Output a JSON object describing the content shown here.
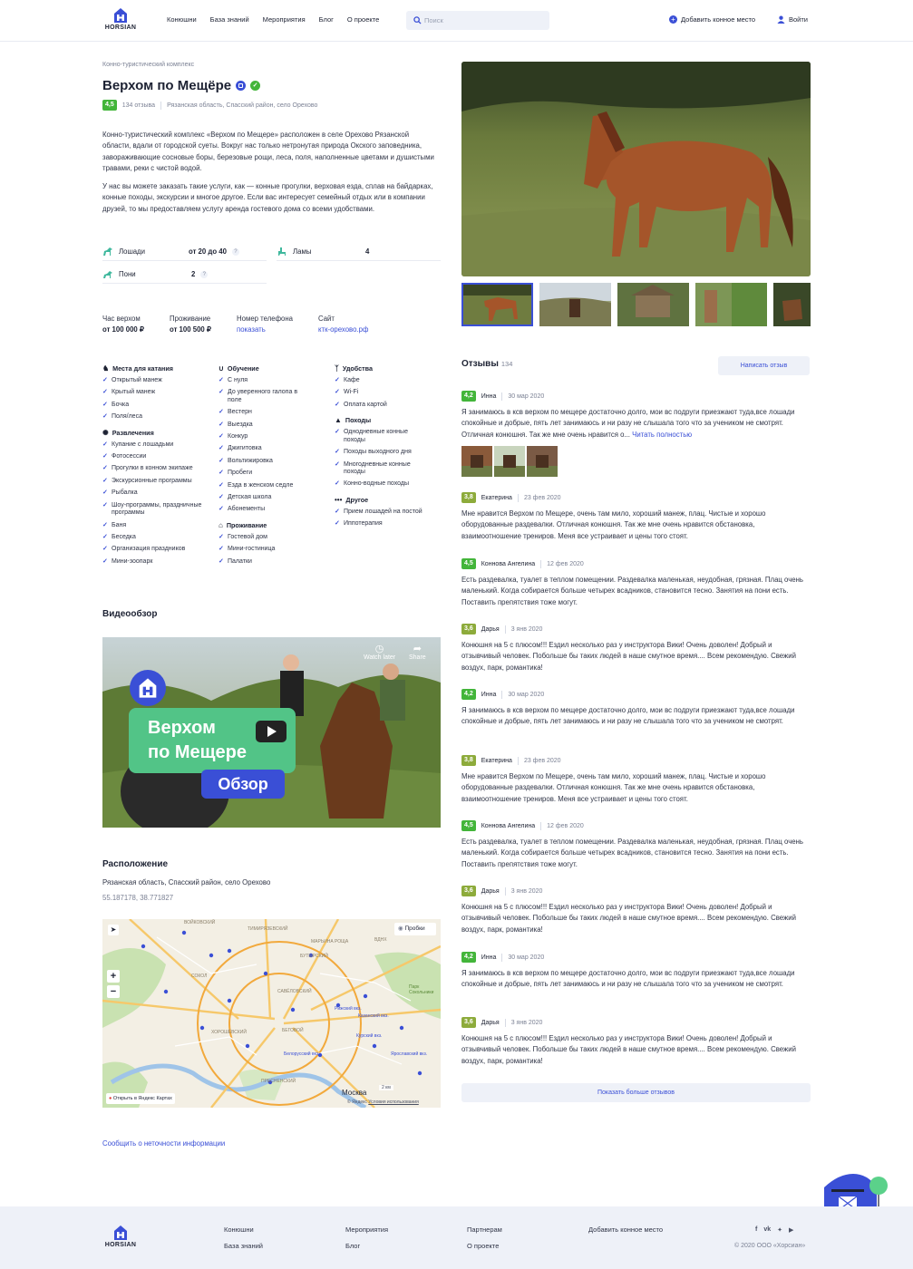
{
  "header": {
    "logo_text": "HORSIAN",
    "nav": [
      "Конюшни",
      "База знаний",
      "Мероприятия",
      "Блог",
      "О проекте"
    ],
    "search_placeholder": "Поиск",
    "add_place": "Добавить конное место",
    "login": "Войти"
  },
  "place": {
    "category": "Конно-туристический комплекс",
    "title": "Верхом по Мещёре",
    "rating": "4,5",
    "reviews_count": "134 отзыва",
    "address": "Рязанская область, Спасский район, село Орехово",
    "description_1": "Конно-туристический комплекс «Верхом по Мещере» расположен в селе Орехово Рязанской области, вдали от городской суеты. Вокруг нас только нетронутая природа Окского заповедника, завораживающие сосновые боры, березовые рощи, леса, поля, наполненные цветами и душистыми травами, реки с чистой водой.",
    "description_2": "У нас вы можете заказать такие услуги, как — конные прогулки, верховая езда, сплав на байдарках, конные походы, экскурсии и многое другое. Если вас интересует семейный отдых или в компании друзей, то мы предоставляем услугу аренда гостевого дома со всеми удобствами."
  },
  "animals": [
    {
      "label": "Лошади",
      "value": "от 20 до 40",
      "help": "?"
    },
    {
      "label": "Ламы",
      "value": "4"
    },
    {
      "label": "Пони",
      "value": "2",
      "help": "?"
    }
  ],
  "info": {
    "ride_label": "Час верхом",
    "ride_value": "от 100 000 ₽",
    "stay_label": "Проживание",
    "stay_value": "от 100 500 ₽",
    "phone_label": "Номер телефона",
    "phone_value": "показать",
    "site_label": "Сайт",
    "site_value": "ктк-орехово.рф"
  },
  "facilities": {
    "col1": [
      {
        "title": "Места для катания",
        "icon": "horse-icon",
        "items": [
          "Открытый манеж",
          "Крытый манеж",
          "Бочка",
          "Поля/леса"
        ]
      },
      {
        "title": "Развлечения",
        "icon": "confetti-icon",
        "items": [
          "Купание с лошадьми",
          "Фотосессии",
          "Прогулки в конном экипаже",
          "Экскурсионные программы",
          "Рыбалка",
          "Шоу-программы, праздничные программы",
          "Баня",
          "Беседка",
          "Организация праздников",
          "Мини-зоопарк"
        ]
      }
    ],
    "col2": [
      {
        "title": "Обучение",
        "icon": "horseshoe-icon",
        "items": [
          "С нуля",
          "До уверенного галопа в поле",
          "Вестерн",
          "Выездка",
          "Конкур",
          "Джигитовка",
          "Вольтижировка",
          "Пробеги",
          "Езда в женском седле",
          "Детская школа",
          "Абонементы"
        ]
      },
      {
        "title": "Проживание",
        "icon": "house-icon",
        "items": [
          "Гостевой дом",
          "Мини-гостиница",
          "Палатки"
        ]
      }
    ],
    "col3": [
      {
        "title": "Удобства",
        "icon": "cutlery-icon",
        "items": [
          "Кафе",
          "Wi-Fi",
          "Оплата картой"
        ]
      },
      {
        "title": "Походы",
        "icon": "hiking-icon",
        "items": [
          "Однодневные конные походы",
          "Походы выходного дня",
          "Многодневные конные походы",
          "Конно-водные походы"
        ]
      },
      {
        "title": "Другое",
        "icon": "dots-icon",
        "items": [
          "Прием лошадей на постой",
          "Иппотерапия"
        ]
      }
    ]
  },
  "video": {
    "section_title": "Видеообзор",
    "overlay_line1": "Верхом",
    "overlay_line2": "по Мещере",
    "overlay_badge": "Обзор",
    "watch_later": "Watch later",
    "share": "Share"
  },
  "location": {
    "section_title": "Расположение",
    "address": "Рязанская область, Спасский район, село Орехово",
    "coords": "55.187178, 38.771827",
    "traffic": "Пробки",
    "open_in": "Открыть в Яндекс Картах",
    "city": "Москва",
    "scale": "2 км",
    "credit": "© Яндекс",
    "terms": "Условия использования",
    "labels": [
      "ВОЙКОВСКИЙ",
      "ТИМИРЯЗЕВСКИЙ",
      "МАРЬИНА РОЩА",
      "БУТЫРСКИЙ",
      "СОКОЛ",
      "САВЁЛОВСКИЙ",
      "ХОРОШЁВСКИЙ",
      "БЕГОВОЙ",
      "ПРЕСНЕНСКИЙ",
      "Белорусский вкз.",
      "Ярославский вкз.",
      "Курский вкз.",
      "Казанский вкз.",
      "Рижский вкз.",
      "Парк Сокольники",
      "ВДНХ"
    ]
  },
  "report_link": "Сообщить о неточности информации",
  "reviews": {
    "title": "Отзывы",
    "count": "134",
    "write": "Написать отзыв",
    "read_more": "Читать полностью",
    "more": "Показать больше отзывов",
    "items": [
      {
        "score": "4,2",
        "name": "Инна",
        "date": "30 мар 2020",
        "text": "Я занимаюсь в ксв верхом по мещере достаточно долго, мои вс подруги приезжают туда,все лошади спокойные и добрые, пять лет занимаюсь и ни разу не слышала того что за учеником не смотрят. Отличная конюшня. Так же мне очень нравится о...",
        "has_more": true,
        "photos": 3
      },
      {
        "score": "3,8",
        "name": "Екатерина",
        "date": "23 фев 2020",
        "text": "Мне нравится Верхом по Мещере, очень там мило, хороший манеж, плац. Чистые и хорошо оборудованные раздевалки. Отличная конюшня. Так же мне очень нравится обстановка, взаимоотношение трениров. Меня все устраивает и цены того стоят."
      },
      {
        "score": "4,5",
        "name": "Коннова Ангелина",
        "date": "12 фев 2020",
        "text": "Есть раздевалка, туалет в теплом помещении. Раздевалка маленькая, неудобная, грязная. Плац очень маленький. Когда собирается больше четырех всадников, становится тесно. Занятия на пони есть. Поставить препятствия тоже могут."
      },
      {
        "score": "3,6",
        "name": "Дарья",
        "date": "3 янв 2020",
        "text": "Конюшня на 5 с плюсом!!! Ездил несколько раз у инструктора Вики! Очень доволен! Добрый и отзывчивый человек. Побольше бы таких людей в наше смутное время.... Всем рекомендую. Свежий воздух, парк, романтика!"
      },
      {
        "score": "4,2",
        "name": "Инна",
        "date": "30 мар 2020",
        "text": "Я занимаюсь в ксв верхом по мещере достаточно долго, мои вс подруги приезжают туда,все лошади спокойные и добрые, пять лет занимаюсь и ни разу не слышала того что за учеником не смотрят."
      },
      {
        "score": "3,8",
        "name": "Екатерина",
        "date": "23 фев 2020",
        "text": "Мне нравится Верхом по Мещере, очень там мило, хороший манеж, плац. Чистые и хорошо оборудованные раздевалки. Отличная конюшня. Так же мне очень нравится обстановка, взаимоотношение трениров. Меня все устраивает и цены того стоят."
      },
      {
        "score": "4,5",
        "name": "Коннова Ангелина",
        "date": "12 фев 2020",
        "text": "Есть раздевалка, туалет в теплом помещении. Раздевалка маленькая, неудобная, грязная. Плац очень маленький. Когда собирается больше четырех всадников, становится тесно. Занятия на пони есть. Поставить препятствия тоже могут."
      },
      {
        "score": "3,6",
        "name": "Дарья",
        "date": "3 янв 2020",
        "text": "Конюшня на 5 с плюсом!!! Ездил несколько раз у инструктора Вики! Очень доволен! Добрый и отзывчивый человек. Побольше бы таких людей в наше смутное время.... Всем рекомендую. Свежий воздух, парк, романтика!"
      },
      {
        "score": "4,2",
        "name": "Инна",
        "date": "30 мар 2020",
        "text": "Я занимаюсь в ксв верхом по мещере достаточно долго, мои вс подруги приезжают туда,все лошади спокойные и добрые, пять лет занимаюсь и ни разу не слышала того что за учеником не смотрят."
      },
      {
        "score": "3,6",
        "name": "Дарья",
        "date": "3 янв 2020",
        "text": "Конюшня на 5 с плюсом!!! Ездил несколько раз у инструктора Вики! Очень доволен! Добрый и отзывчивый человек. Побольше бы таких людей в наше смутное время.... Всем рекомендую. Свежий воздух, парк, романтика!"
      }
    ]
  },
  "footer": {
    "col1": [
      "Конюшни",
      "База знаний"
    ],
    "col2": [
      "Мероприятия",
      "Блог"
    ],
    "col3": [
      "Партнерам",
      "О проекте"
    ],
    "col4": [
      "Добавить конное место"
    ],
    "socials": [
      "facebook-icon",
      "vk-icon",
      "twitter-icon",
      "youtube-icon"
    ],
    "copyright": "© 2020 ООО «Хорсиан»"
  },
  "colors": {
    "accent": "#3a4fd6",
    "score_green": "#43b53a",
    "score_olive": "#8dab3b",
    "teal_icon": "#3fb89d"
  }
}
